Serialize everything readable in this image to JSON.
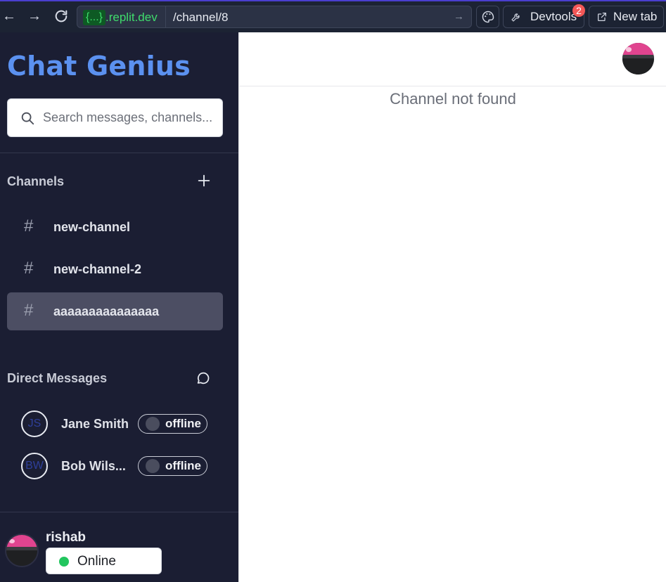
{
  "browser": {
    "url_badge": "{...}",
    "url_domain": ".replit.dev",
    "url_path": "/channel/8",
    "devtools_label": "Devtools",
    "devtools_badge": "2",
    "new_tab_label": "New tab"
  },
  "sidebar": {
    "app_title": "Chat Genius",
    "search_placeholder": "Search messages, channels...",
    "channels_title": "Channels",
    "channels": [
      {
        "name": "new-channel",
        "active": false
      },
      {
        "name": "new-channel-2",
        "active": false
      },
      {
        "name": "aaaaaaaaaaaaaaa",
        "active": true
      }
    ],
    "dm_title": "Direct Messages",
    "direct_messages": [
      {
        "initials": "JS",
        "name": "Jane Smith",
        "status": "offline"
      },
      {
        "initials": "BW",
        "name": "Bob Wils...",
        "status": "offline"
      }
    ],
    "current_user": {
      "name": "rishab",
      "status": "Online",
      "status_color": "#22c55e"
    }
  },
  "main": {
    "message": "Channel not found"
  },
  "colors": {
    "accent": "#5b91f0",
    "sidebar_bg": "#1b1e33",
    "active_channel_bg": "#4c4e63"
  }
}
